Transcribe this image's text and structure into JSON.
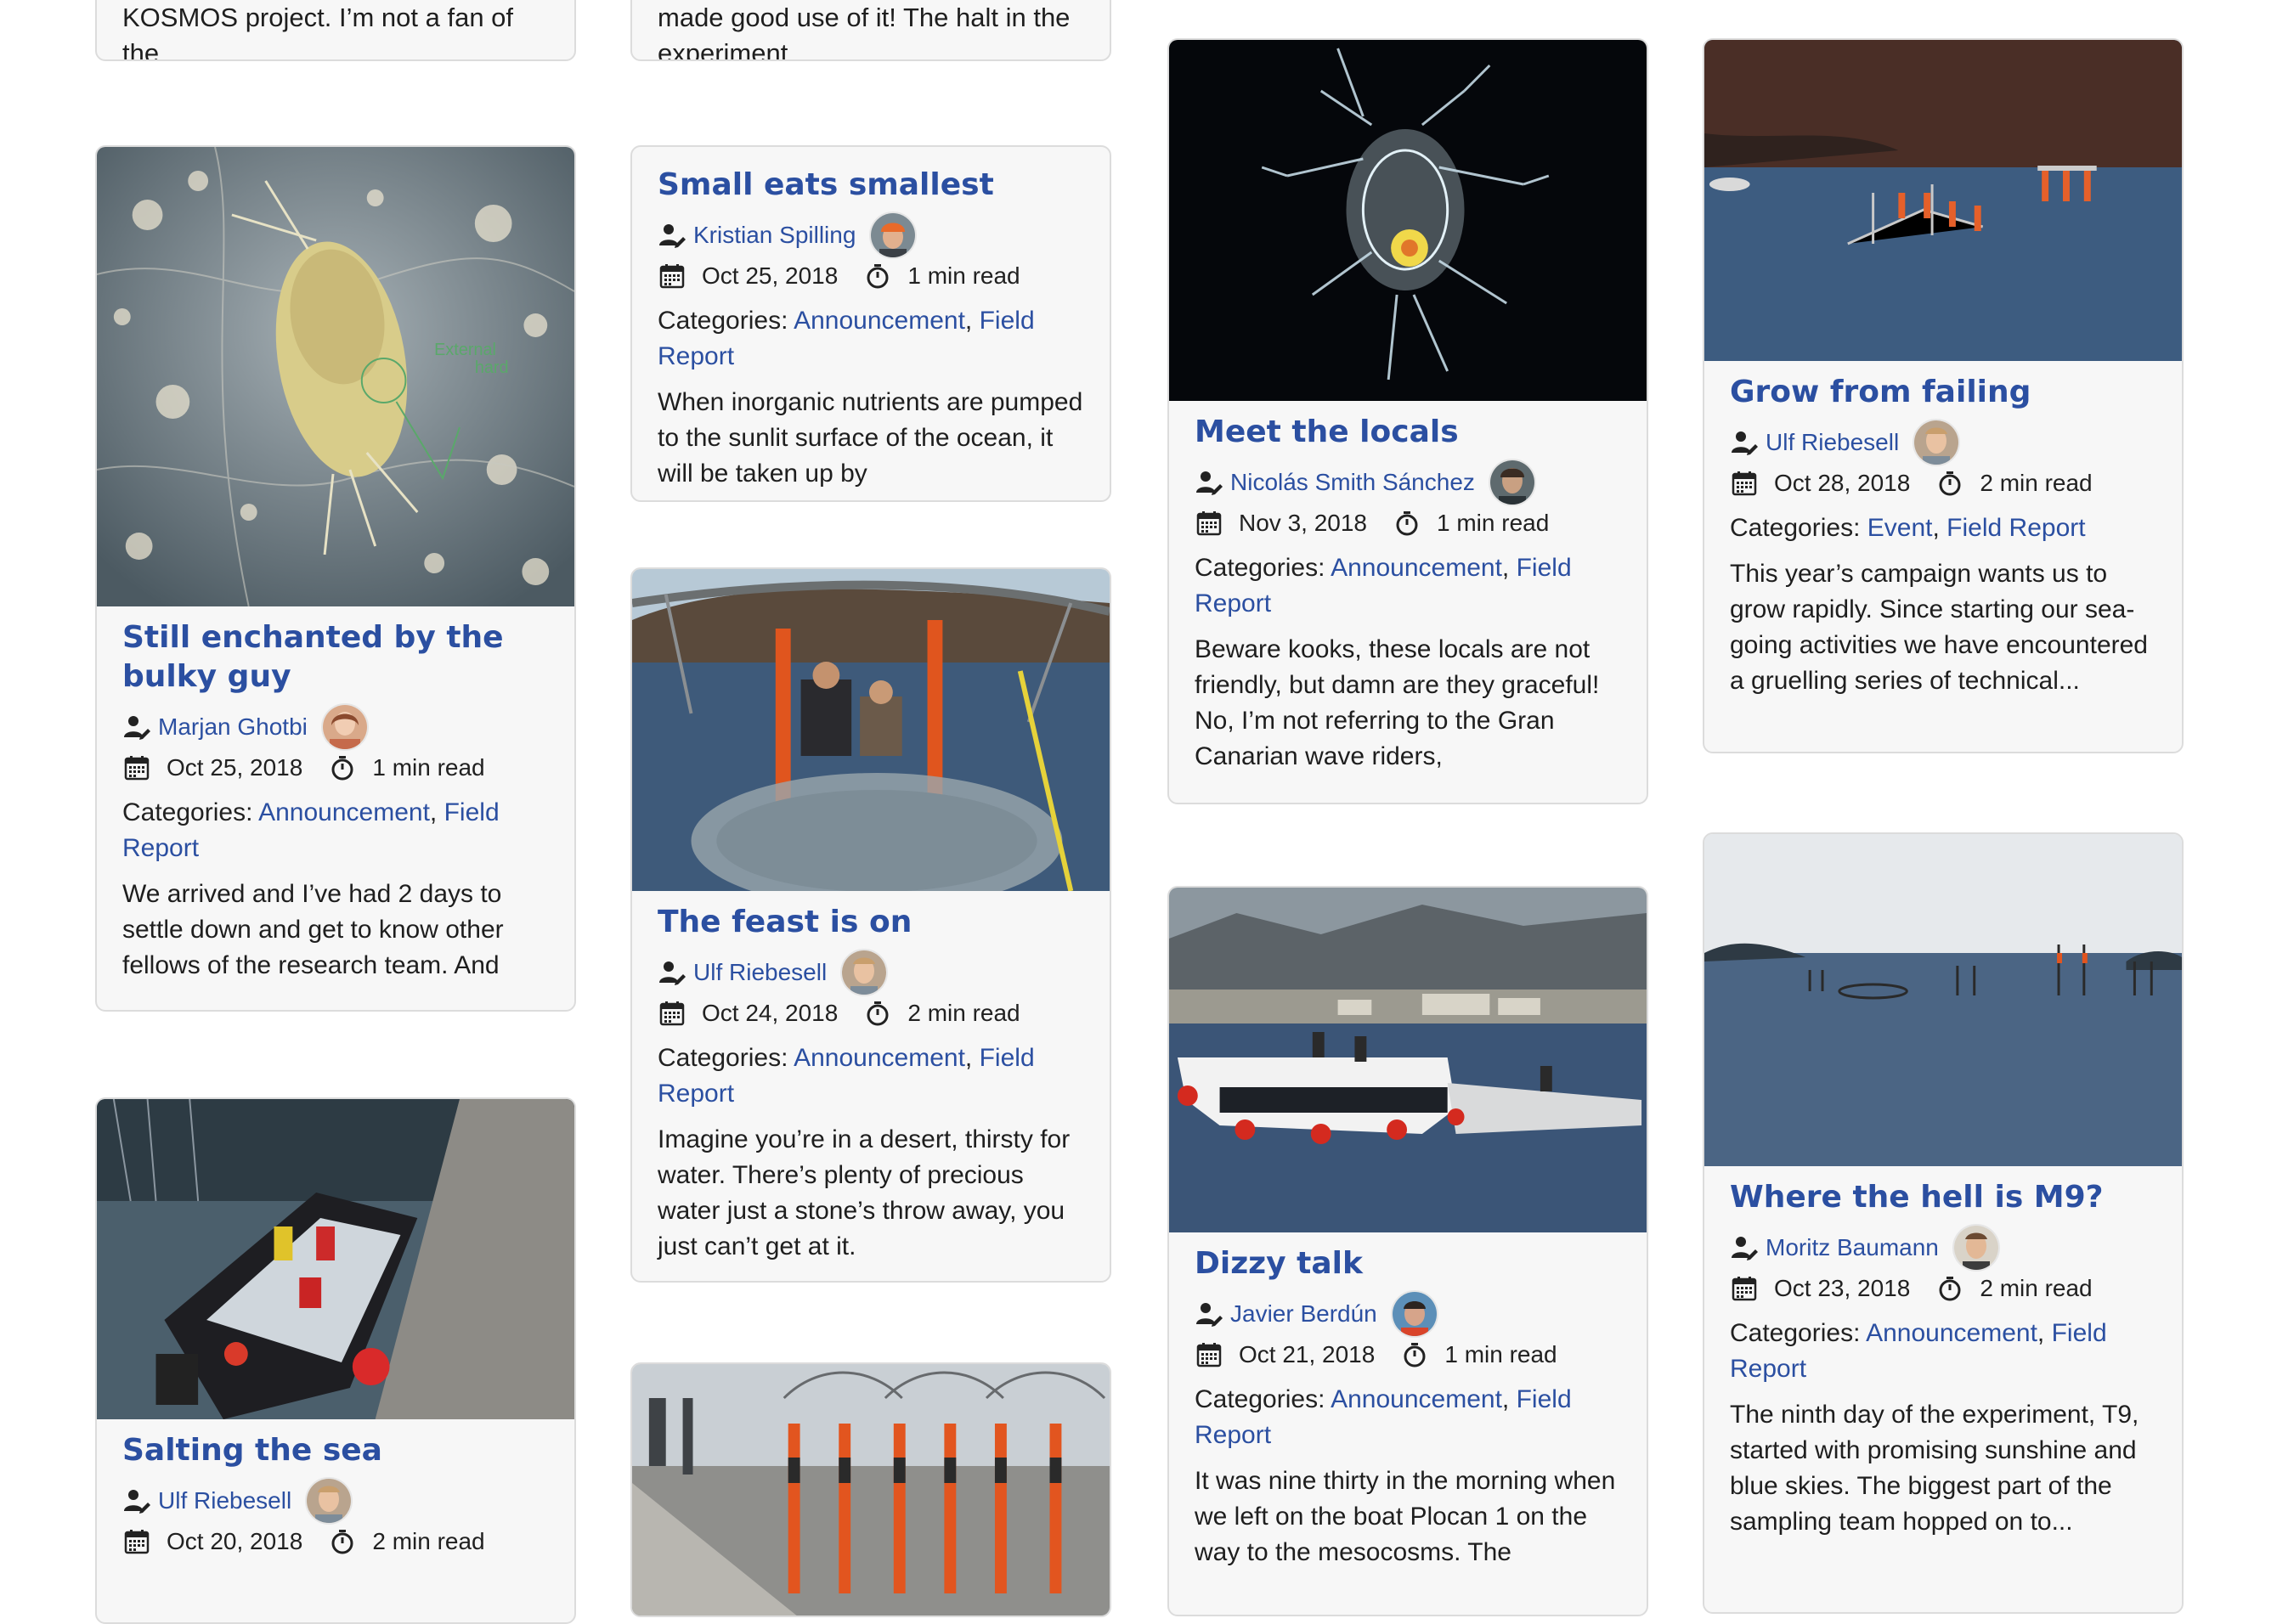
{
  "stubs": [
    {
      "text": "KOSMOS project. I’m not a fan of the"
    },
    {
      "text": "made good use of it! The halt in the experiment"
    }
  ],
  "labels": {
    "categories_prefix": "Categories:",
    "separator": ","
  },
  "posts": [
    {
      "title": "Still enchanted by the bulky guy",
      "author": "Marjan Ghotbi",
      "date": "Oct 25, 2018",
      "read_time": "1 min read",
      "categories": [
        "Announcement",
        "Field Report"
      ],
      "excerpt": "We arrived and I’ve had 2 days to settle down and get to know other fellows of the research team. And",
      "image_annotation": [
        "External",
        "hard"
      ]
    },
    {
      "title": "Salting the sea",
      "author": "Ulf Riebesell",
      "date": "Oct 20, 2018",
      "read_time": "2 min read"
    },
    {
      "title": "Small eats smallest",
      "author": "Kristian Spilling",
      "date": "Oct 25, 2018",
      "read_time": "1 min read",
      "categories": [
        "Announcement",
        "Field Report"
      ],
      "excerpt": "When inorganic nutrients are pumped to the sunlit surface of the ocean, it will be taken up by"
    },
    {
      "title": "The feast is on",
      "author": "Ulf Riebesell",
      "date": "Oct 24, 2018",
      "read_time": "2 min read",
      "categories": [
        "Announcement",
        "Field Report"
      ],
      "excerpt": "Imagine you’re in a desert, thirsty for water. There’s plenty of precious water just a stone’s throw away, you just can’t get at it."
    },
    {
      "title": "Meet the locals",
      "author": "Nicolás Smith Sánchez",
      "date": "Nov 3, 2018",
      "read_time": "1 min read",
      "categories": [
        "Announcement",
        "Field Report"
      ],
      "excerpt": "Beware kooks, these locals are not friendly, but damn are they graceful! No, I’m not referring to the Gran Canarian wave riders,"
    },
    {
      "title": "Dizzy talk",
      "author": "Javier Berdún",
      "date": "Oct 21, 2018",
      "read_time": "1 min read",
      "categories": [
        "Announcement",
        "Field Report"
      ],
      "excerpt": "It was nine thirty in the morning when we left on the boat Plocan 1 on the way to the mesocosms. The"
    },
    {
      "title": "Grow from failing",
      "author": "Ulf Riebesell",
      "date": "Oct 28, 2018",
      "read_time": "2 min read",
      "categories": [
        "Event",
        "Field Report"
      ],
      "excerpt": "This year’s campaign wants us to grow rapidly. Since starting our sea-going activities we have encountered a gruelling series of technical..."
    },
    {
      "title": "Where the hell is M9?",
      "author": "Moritz Baumann",
      "date": "Oct 23, 2018",
      "read_time": "2 min read",
      "categories": [
        "Announcement",
        "Field Report"
      ],
      "excerpt": "The ninth day of the experiment, T9, started with promising sunshine and blue skies. The biggest part of the sampling team hopped on to..."
    }
  ]
}
